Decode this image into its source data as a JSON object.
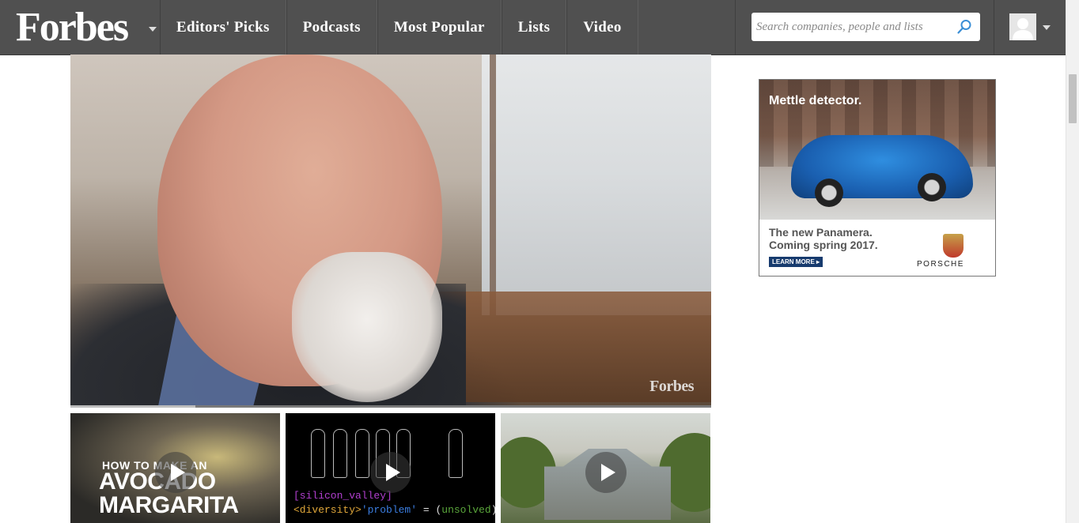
{
  "header": {
    "logo": "Forbes",
    "nav": [
      "Editors' Picks",
      "Podcasts",
      "Most Popular",
      "Lists",
      "Video"
    ],
    "search_placeholder": "Search companies, people and lists"
  },
  "video": {
    "watermark": "Forbes",
    "progress_fraction": 0.195
  },
  "thumbnails": [
    {
      "title_small": "HOW TO MAKE AN",
      "title_big": "AVOCADO MARGARITA"
    },
    {
      "code_line1": "[silicon_valley]",
      "code_tag": "<diversity>",
      "code_string": "'problem'",
      "code_eq": " = (",
      "code_value": "unsolved",
      "code_end": ");"
    },
    {}
  ],
  "ad": {
    "headline": "Mettle detector.",
    "copy_line1": "The new Panamera.",
    "copy_line2": "Coming spring 2017.",
    "cta": "LEARN MORE ▸",
    "brand": "PORSCHE"
  },
  "colors": {
    "header_bg": "#505050",
    "cta_bg": "#173b6e"
  }
}
